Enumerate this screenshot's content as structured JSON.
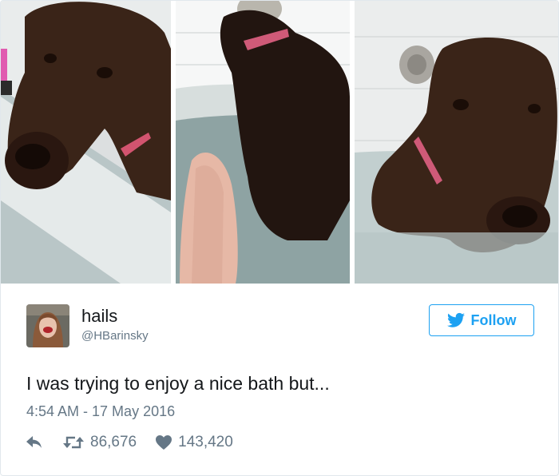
{
  "tweet": {
    "name": "hails",
    "handle": "@HBarinsky",
    "text": "I was trying to enjoy a nice bath but...",
    "timestamp": "4:54 AM - 17 May 2016",
    "follow_label": "Follow",
    "retweets": "86,676",
    "likes": "143,420"
  },
  "icons": {
    "follow_button": "twitter-bird-icon",
    "reply": "reply-arrow-icon",
    "retweet": "retweet-icon",
    "like": "heart-icon"
  },
  "colors": {
    "brand_blue": "#1da1f2",
    "text_primary": "#14171a",
    "text_secondary": "#657786",
    "border": "#e1e8ed"
  },
  "photos": [
    {
      "subject": "dog-in-bathtub-looking-at-camera"
    },
    {
      "subject": "dog-standing-in-bath-water-from-behind"
    },
    {
      "subject": "dog-sitting-in-bathtub-sad-face"
    }
  ]
}
